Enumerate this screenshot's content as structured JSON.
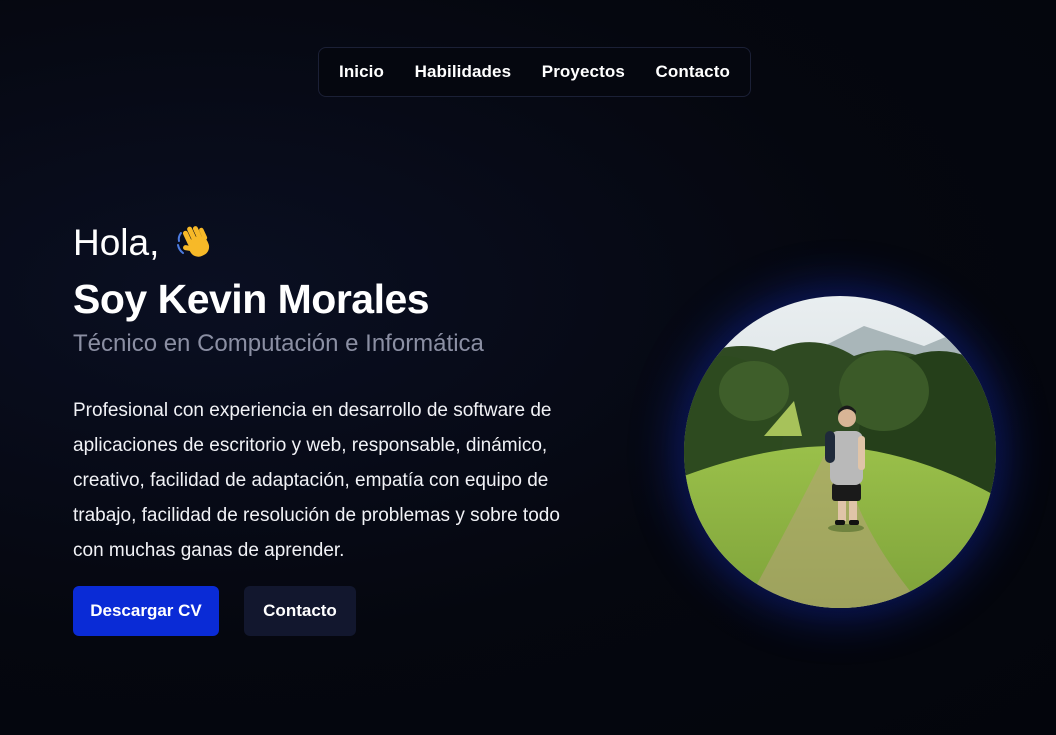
{
  "nav": {
    "items": [
      {
        "label": "Inicio"
      },
      {
        "label": "Habilidades"
      },
      {
        "label": "Proyectos"
      },
      {
        "label": "Contacto"
      }
    ]
  },
  "hero": {
    "greeting": "Hola,",
    "wave_icon": "waving-hand-icon",
    "name": "Soy Kevin Morales",
    "role": "Técnico en Computación e Informática",
    "bio": "Profesional con experiencia en desarrollo de software de aplicaciones de escritorio y web, responsable, dinámico, creativo, facilidad de adaptación, empatía con equipo de trabajo, facilidad de resolución de problemas y sobre todo con muchas ganas de aprender.",
    "buttons": {
      "download_cv": "Descargar CV",
      "contact": "Contacto"
    }
  },
  "colors": {
    "background": "#03050f",
    "primary_button": "#0a2bd6",
    "secondary_button": "#12172e",
    "muted_text": "#8b8fa3"
  }
}
